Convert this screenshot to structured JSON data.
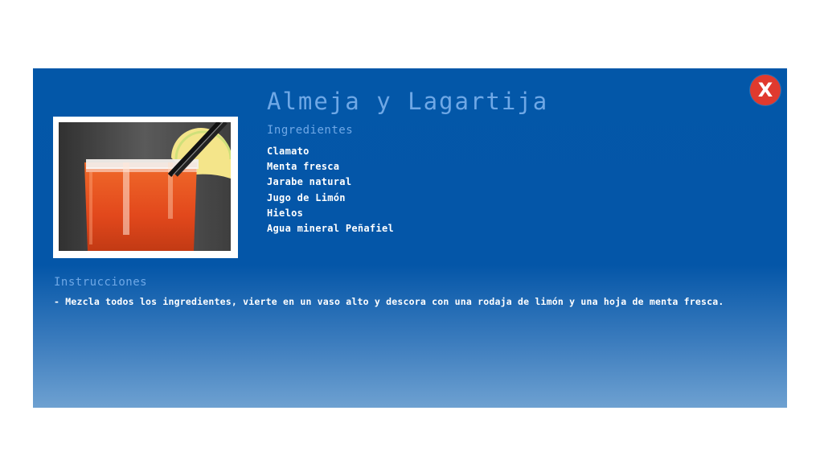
{
  "modal": {
    "close_label": "X",
    "title": "Almeja y Lagartija",
    "ingredients_heading": "Ingredientes",
    "ingredients": [
      "Clamato",
      "Menta fresca",
      "Jarabe natural",
      "Jugo de Limón",
      "Hielos",
      "Agua mineral Peñafiel"
    ],
    "instructions_heading": "Instrucciones",
    "instructions_text": "- Mezcla todos los ingredientes, vierte en un vaso alto y descora con una rodaja de limón y una hoja de menta fresca."
  },
  "colors": {
    "panel_blue": "#0456a8",
    "heading_blue": "#6fa8e6",
    "close_red": "#e03a2e"
  },
  "icons": {
    "close": "close-icon"
  }
}
